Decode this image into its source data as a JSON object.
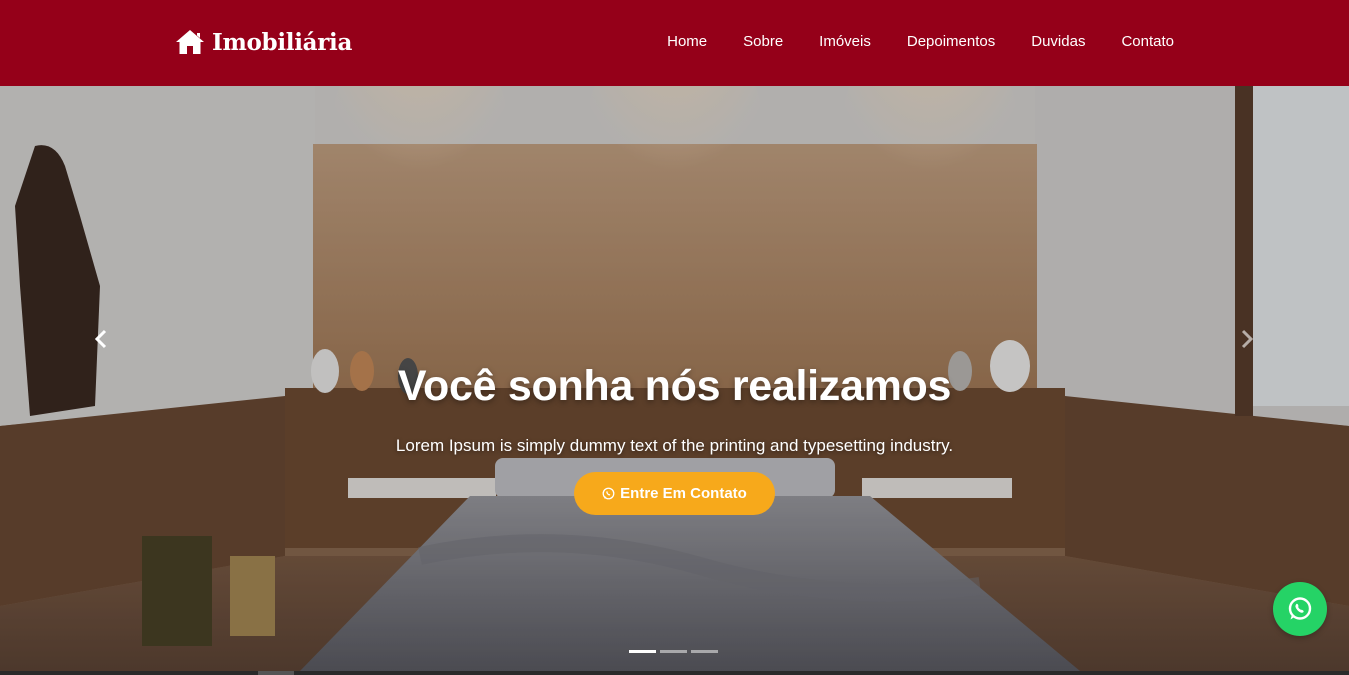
{
  "brand": {
    "name": "Imobiliária",
    "icon": "home-icon"
  },
  "nav": {
    "items": [
      {
        "label": "Home"
      },
      {
        "label": "Sobre"
      },
      {
        "label": "Imóveis"
      },
      {
        "label": "Depoimentos"
      },
      {
        "label": "Duvidas"
      },
      {
        "label": "Contato"
      }
    ]
  },
  "hero": {
    "title": "Você sonha nós realizamos",
    "subtitle": "Lorem Ipsum is simply dummy text of the printing and typesetting industry.",
    "cta_label": "Entre Em Contato",
    "cta_icon": "whatsapp-icon",
    "slide_count": 3,
    "active_slide": 1
  },
  "colors": {
    "navbar": "#950019",
    "cta": "#f7a91b",
    "whatsapp": "#25d366"
  }
}
